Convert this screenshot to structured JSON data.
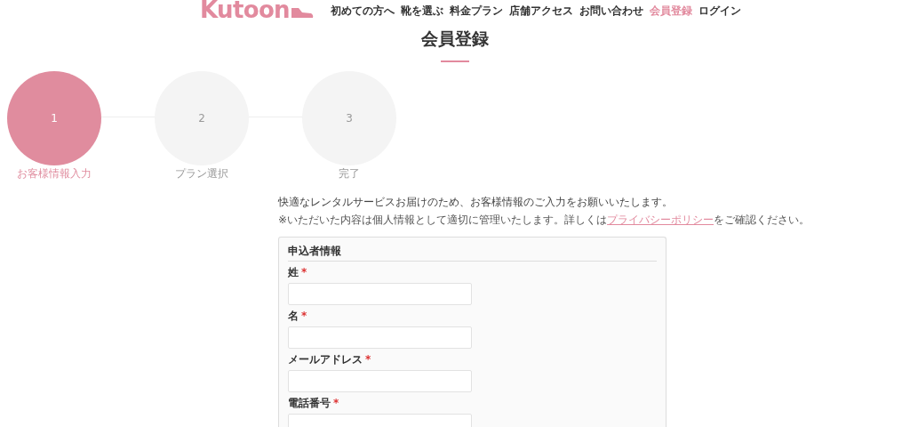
{
  "logo": {
    "text": "Kutoon"
  },
  "nav": [
    {
      "label": "初めての方へ",
      "selected": false
    },
    {
      "label": "靴を選ぶ",
      "selected": false
    },
    {
      "label": "料金プラン",
      "selected": false
    },
    {
      "label": "店舗アクセス",
      "selected": false
    },
    {
      "label": "お問い合わせ",
      "selected": false
    },
    {
      "label": "会員登録",
      "selected": true
    },
    {
      "label": "ログイン",
      "selected": false
    }
  ],
  "page_title": "会員登録",
  "steps": [
    {
      "number": "1",
      "label": "お客様情報入力",
      "selected": true
    },
    {
      "number": "2",
      "label": "プラン選択",
      "selected": false
    },
    {
      "number": "3",
      "label": "完了",
      "selected": false
    }
  ],
  "intro": "快適なレンタルサービスお届けのため、お客様情報のご入力をお願いいたします。",
  "note": {
    "before": "※いただいた内容は個人情報として適切に管理いたします。詳しくは",
    "link": "プライバシーポリシー",
    "after": "をご確認ください。"
  },
  "form": {
    "title": "申込者情報",
    "fields": [
      {
        "label": "姓",
        "required_mark": "*"
      },
      {
        "label": "名",
        "required_mark": "*"
      },
      {
        "label": "メールアドレス",
        "required_mark": "*"
      },
      {
        "label": "電話番号",
        "required_mark": "*"
      }
    ]
  }
}
